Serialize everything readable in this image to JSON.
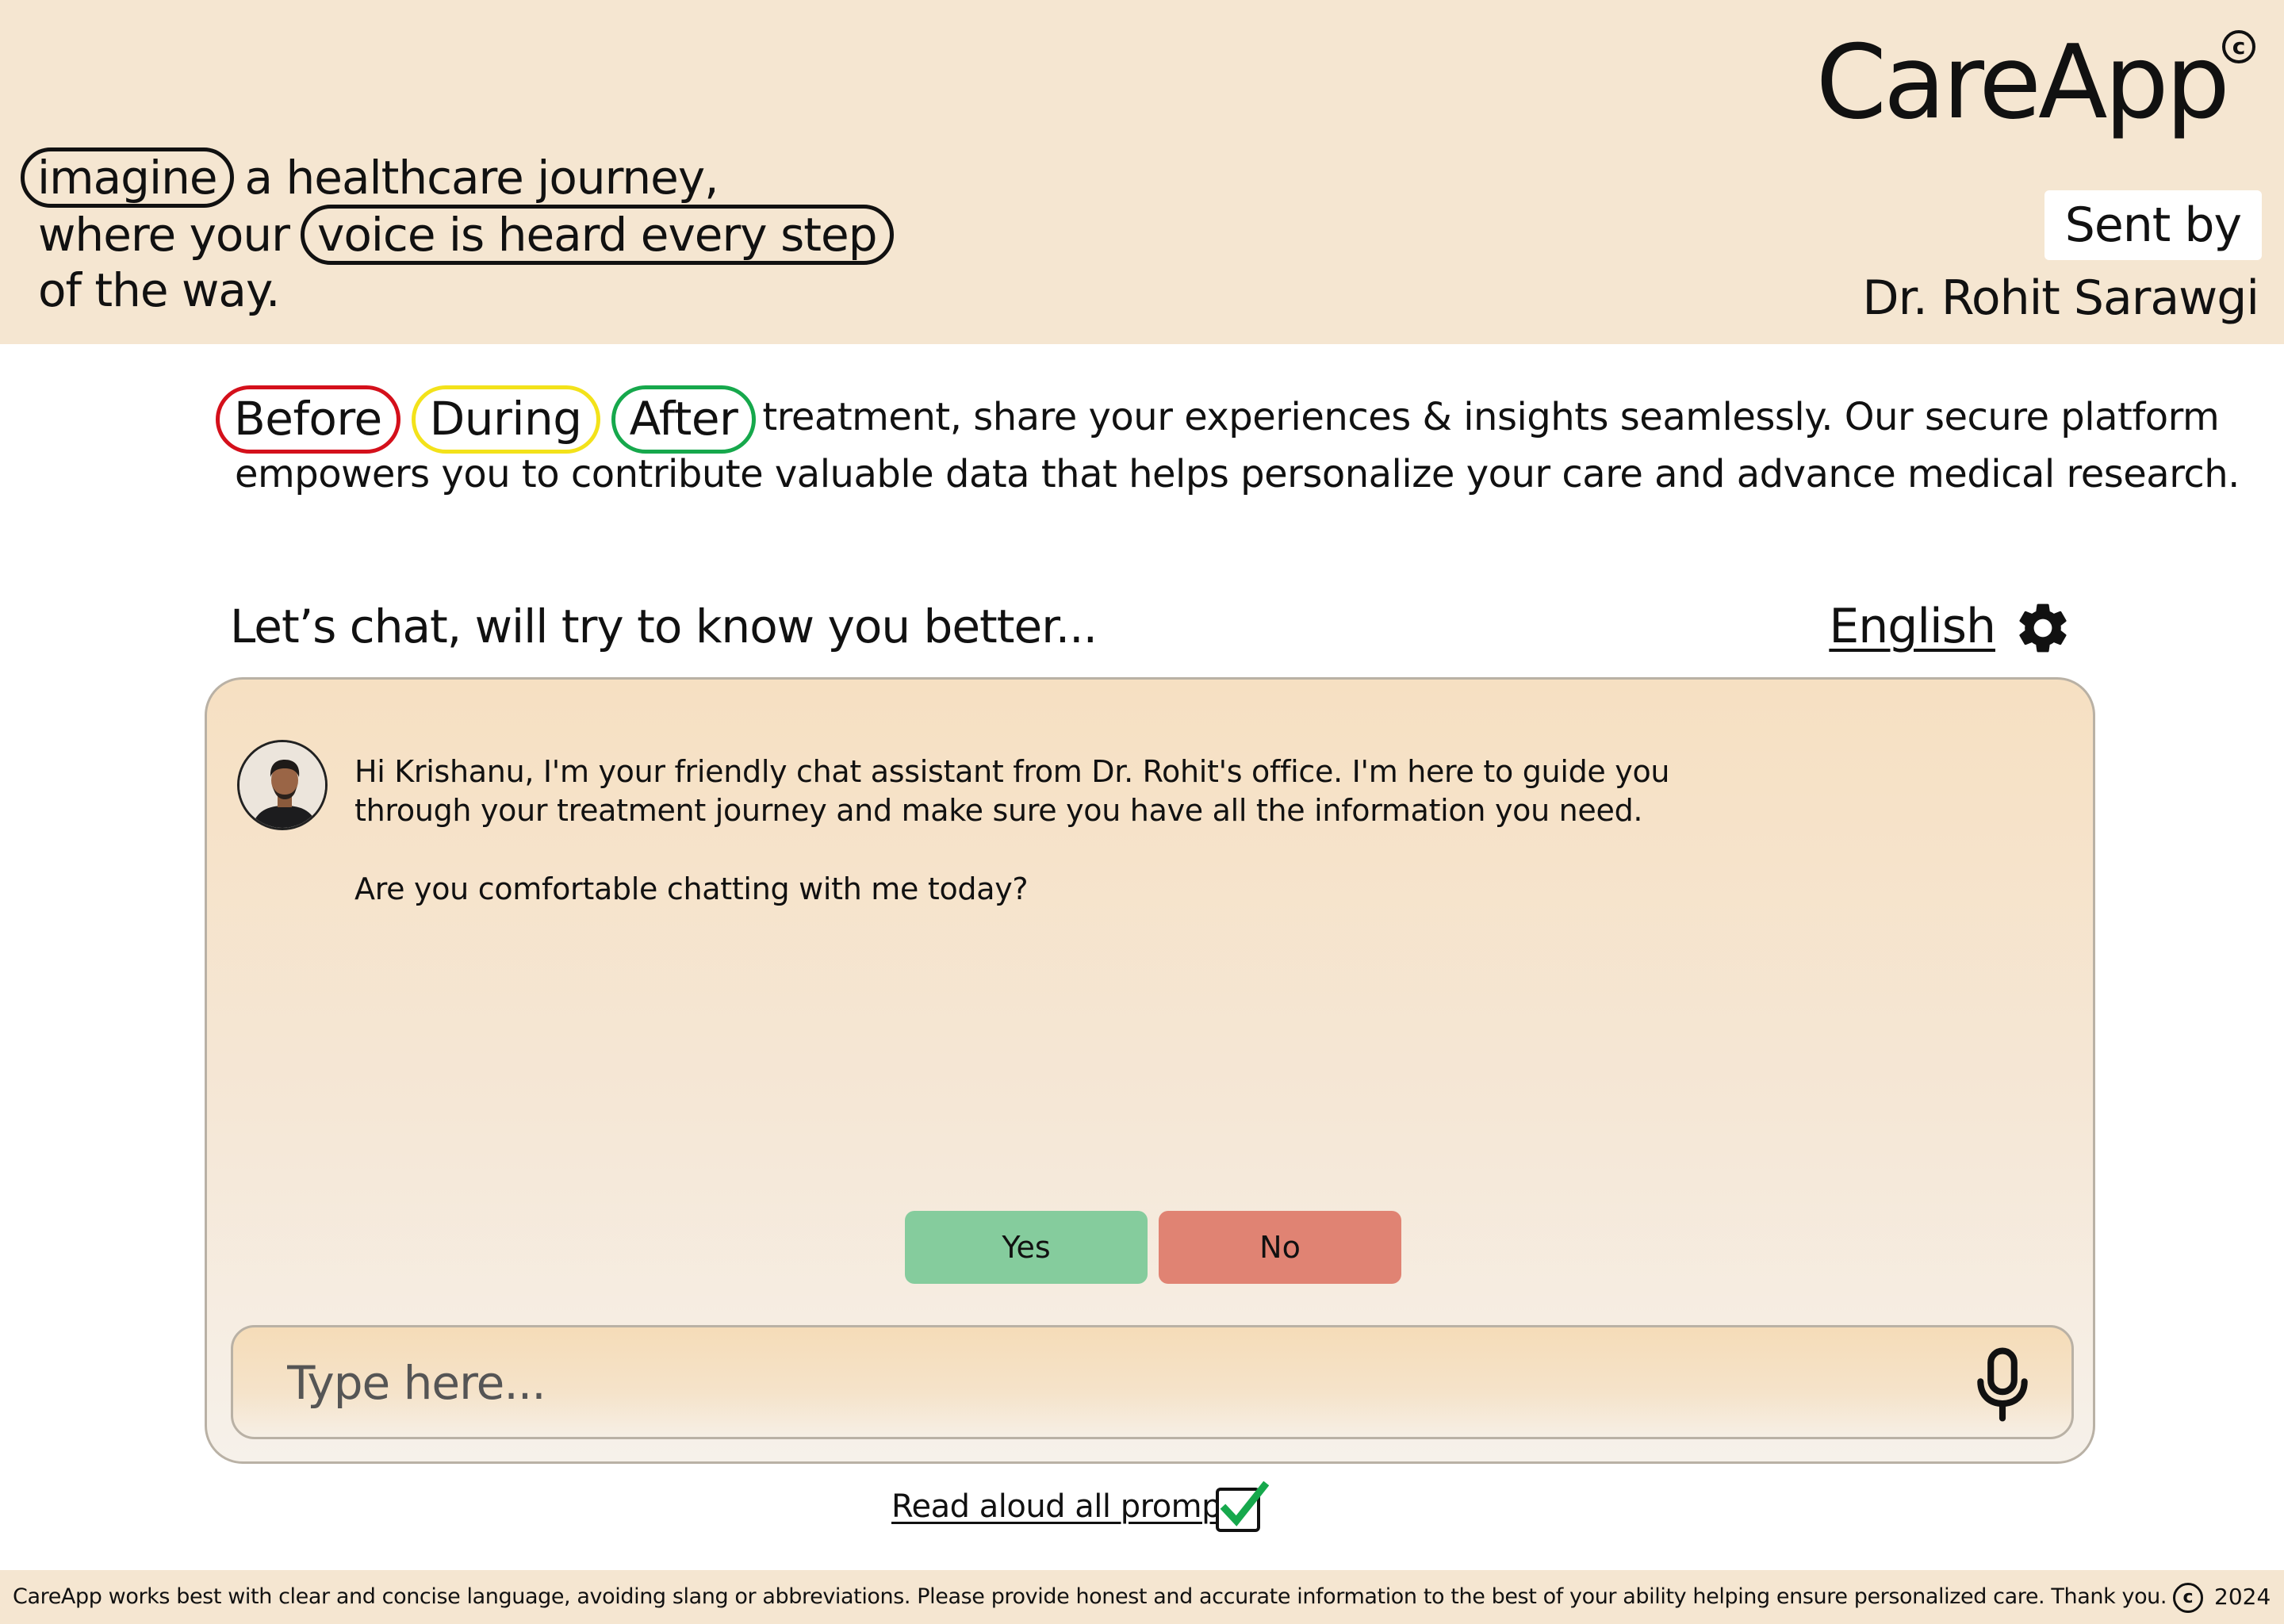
{
  "app": {
    "name": "CareApp",
    "copyright_symbol": "c"
  },
  "header": {
    "tagline": {
      "pill_1": "imagine",
      "line_1_rest": "a healthcare journey,",
      "line_2_start": "where your",
      "pill_2": "voice is heard every step",
      "line_3": "of the way."
    },
    "sent_by_label": "Sent by",
    "doctor_name": "Dr. Rohit Sarawgi"
  },
  "intro": {
    "phases": [
      "Before",
      "During",
      "After"
    ],
    "phase_colors": [
      "#d4101b",
      "#f3e21a",
      "#16a84c"
    ],
    "line_1_rest": "treatment, share your experiences & insights seamlessly. Our secure platform",
    "line_2": "empowers you to contribute valuable data that helps personalize your care and advance medical research."
  },
  "chat": {
    "title": "Let’s chat, will try to know you better...",
    "language": "English",
    "settings_icon": "gear-icon",
    "message": {
      "line_1": "Hi Krishanu, I'm your friendly chat assistant from Dr. Rohit's office. I'm here to guide you",
      "line_2": "through your treatment journey and make sure you have all the information you need.",
      "line_3": "Are you comfortable chatting with me today?"
    },
    "options": {
      "yes": "Yes",
      "no": "No",
      "yes_color": "#85cc9d",
      "no_color": "#e08373"
    },
    "input": {
      "placeholder": "Type here...",
      "value": ""
    },
    "mic_icon": "microphone-icon"
  },
  "read_aloud": {
    "label": "Read aloud all prompts",
    "checked": true
  },
  "footer": {
    "text": "CareApp works best with clear and concise language, avoiding slang or abbreviations. Please provide honest and accurate information to the best of your ability helping ensure personalized care. Thank you.",
    "copyright_symbol": "c",
    "year": "2024"
  }
}
